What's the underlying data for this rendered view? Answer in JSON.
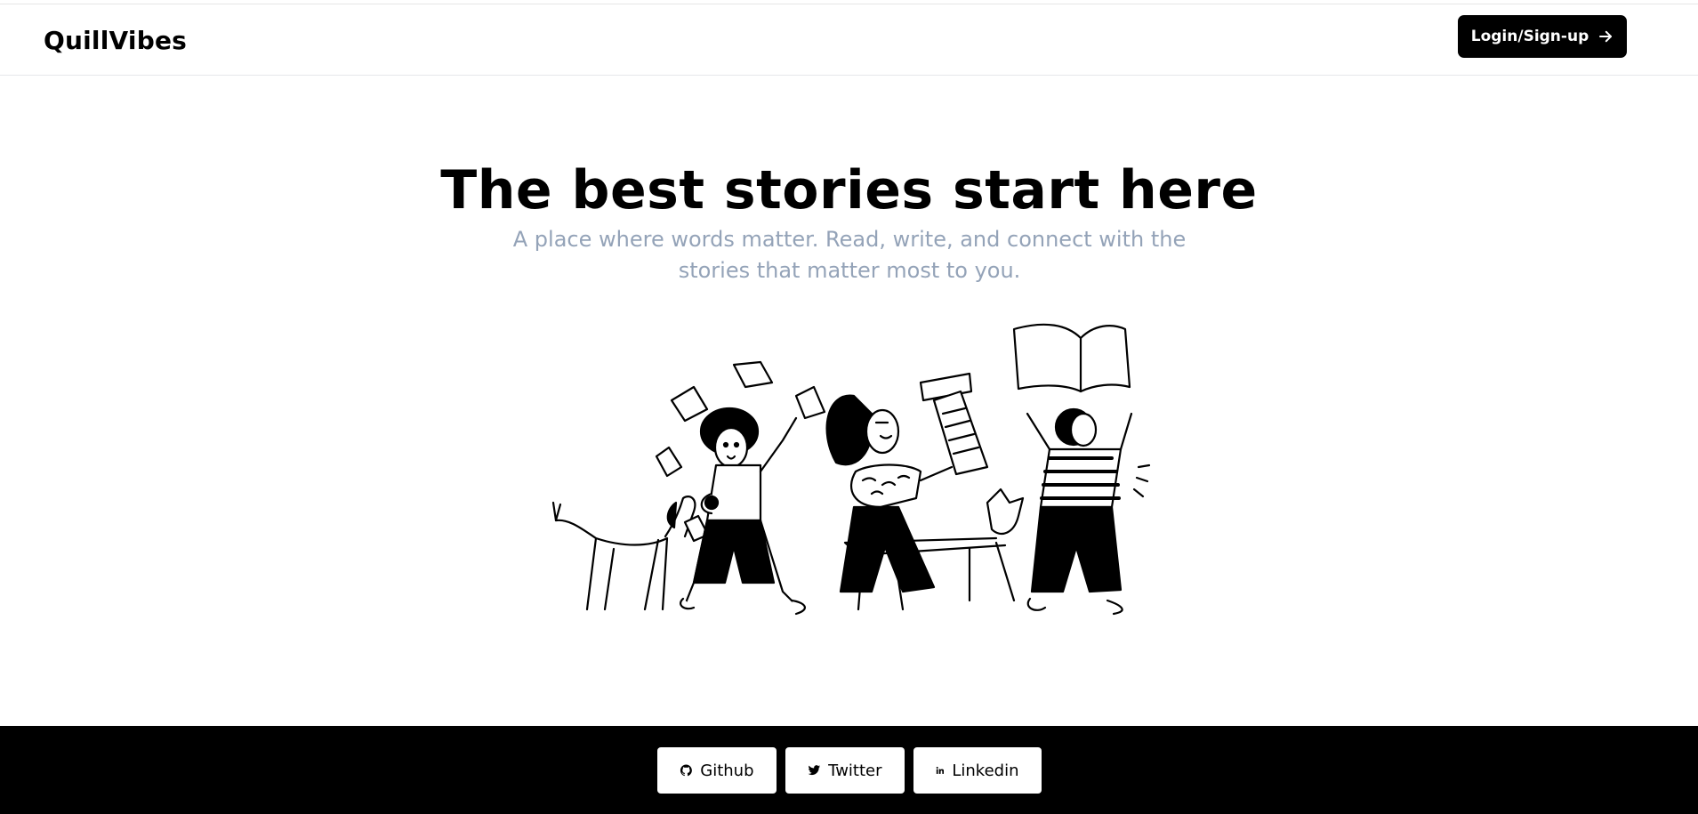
{
  "header": {
    "brand": "QuillVibes",
    "login_label": "Login/Sign-up",
    "login_icon": "arrow-right-icon"
  },
  "hero": {
    "title": "The best stories start here",
    "subtitle": "A place where words matter. Read, write, and connect with the stories that matter most to you."
  },
  "footer": {
    "links": [
      {
        "label": "Github",
        "icon": "github-icon"
      },
      {
        "label": "Twitter",
        "icon": "twitter-icon"
      },
      {
        "label": "Linkedin",
        "icon": "linkedin-icon"
      }
    ]
  },
  "colors": {
    "primary": "#000000",
    "background": "#ffffff",
    "subtitle": "#94a3b8",
    "border": "#e5e7eb"
  }
}
